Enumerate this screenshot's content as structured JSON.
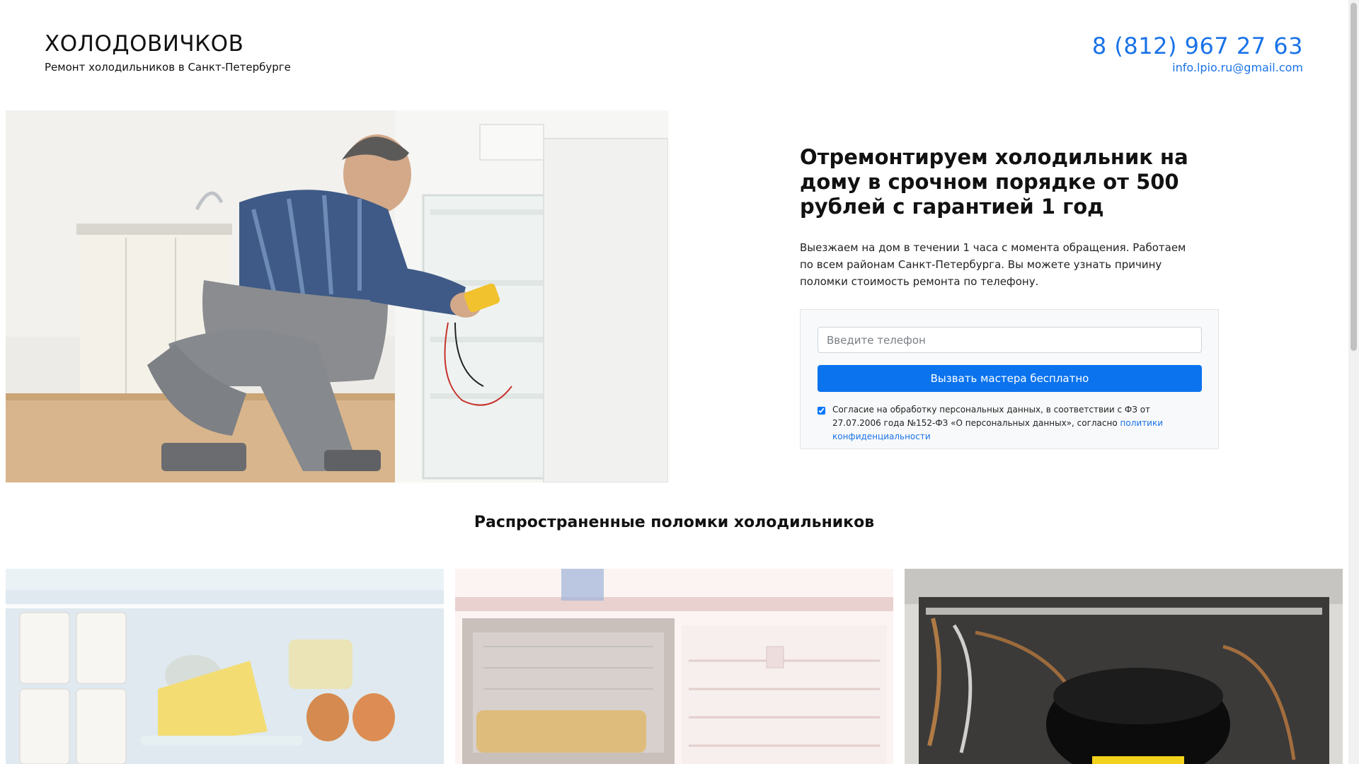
{
  "header": {
    "brand_title": "ХОЛОДОВИЧКОВ",
    "brand_subtitle": "Ремонт холодильников в Санкт-Петербурге",
    "phone": "8 (812) 967 27 63",
    "email": "info.lpio.ru@gmail.com"
  },
  "hero": {
    "title": "Отремонтируем холодильник на дому в срочном порядке от 500 рублей с гарантией 1 год",
    "text": "Выезжаем на дом в течении 1 часа с момента обращения. Работаем по всем районам Санкт-Петербурга. Вы можете узнать причину поломки стоимость ремонта по телефону."
  },
  "form": {
    "phone_placeholder": "Введите телефон",
    "submit_label": "Вызвать мастера бесплатно",
    "consent_text": "Согласие на обработку персональных данных, в соответствии с ФЗ от 27.07.2006 года №152-ФЗ «О персональных данных», согласно",
    "policy_link": "политики конфиденциальности",
    "consent_checked": true
  },
  "section": {
    "title": "Распространенные поломки холодильников"
  },
  "colors": {
    "accent": "#1a73e8",
    "button": "#0b73ee",
    "form_bg": "#f8f9fa"
  }
}
